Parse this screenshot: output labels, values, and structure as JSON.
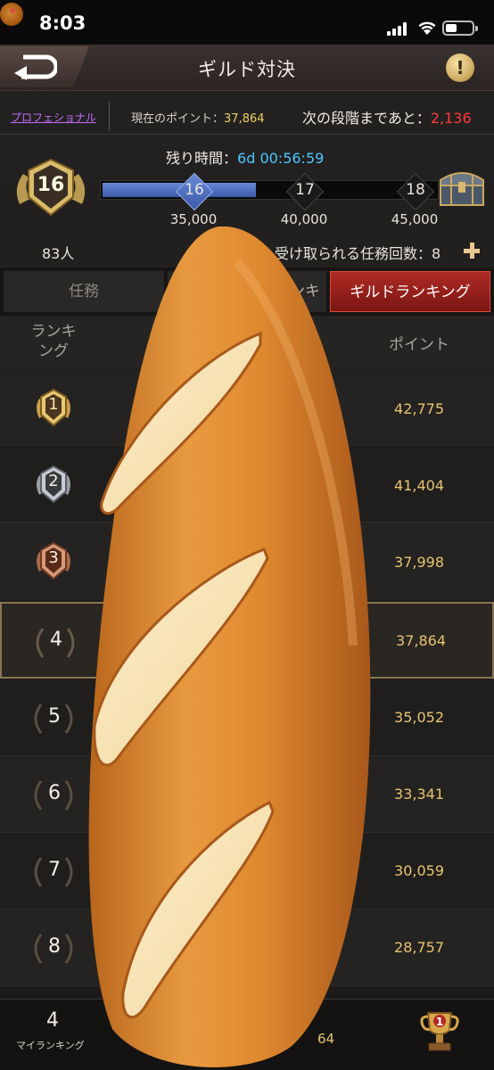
{
  "status_bar": {
    "time": "8:03"
  },
  "header": {
    "title": "ギルド対決",
    "info_label": "!"
  },
  "info": {
    "tier_link": "プロフェショナル",
    "current_points_label": "現在のポイント：",
    "current_points_value": "37,864",
    "next_stage_label": "次の段階まであと：",
    "next_stage_value": "2,136"
  },
  "remaining": {
    "label": "残り時間：",
    "value": "6d 00:56:59"
  },
  "progress": {
    "current_rank": "16",
    "fill_fraction": 0.46,
    "milestones": [
      {
        "label": "16",
        "points": "35,000",
        "reached": true
      },
      {
        "label": "17",
        "points": "40,000",
        "reached": false
      },
      {
        "label": "18",
        "points": "45,000",
        "reached": false
      }
    ]
  },
  "summary": {
    "members": "83人",
    "missions": "受け取られる任務回数：8"
  },
  "tabs": {
    "tasks": "任務",
    "personal": "ランキ",
    "guild": "ギルドランキング"
  },
  "table": {
    "rank_header": "ランキ\nング",
    "points_header": "ポイント",
    "rows": [
      {
        "rank": "1",
        "points": "42,775"
      },
      {
        "rank": "2",
        "points": "41,404"
      },
      {
        "rank": "3",
        "points": "37,998"
      },
      {
        "rank": "4",
        "points": "37,864"
      },
      {
        "rank": "5",
        "points": "35,052"
      },
      {
        "rank": "6",
        "points": "33,341"
      },
      {
        "rank": "7",
        "points": "30,059"
      },
      {
        "rank": "8",
        "points": "28,757"
      }
    ]
  },
  "bottom": {
    "my_rank": "4",
    "my_rank_label": "マイランキング",
    "points_partial": "64",
    "trophy_rank": "1"
  },
  "colors": {
    "accent_red": "#b02a24",
    "gold": "#e8c470",
    "cyan": "#4cc8ff",
    "link_purple": "#c46cff"
  }
}
